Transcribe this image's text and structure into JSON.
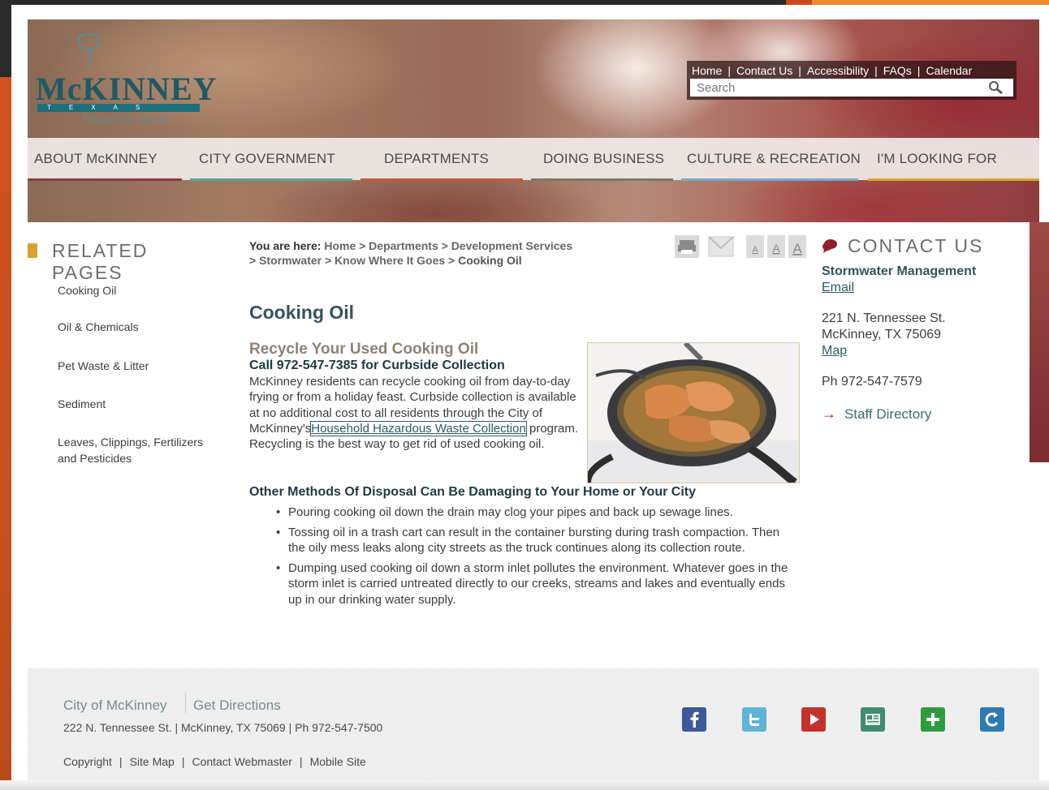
{
  "util": {
    "links": [
      "Home",
      "Contact Us",
      "Accessibility",
      "FAQs",
      "Calendar"
    ],
    "sep": "|",
    "search_placeholder": "Search"
  },
  "logo": {
    "word": "McKINNEY",
    "band": "TEXAS",
    "tagline": "Unique by nature."
  },
  "nav": {
    "items": [
      "ABOUT McKINNEY",
      "CITY GOVERNMENT",
      "DEPARTMENTS",
      "DOING BUSINESS",
      "CULTURE & RECREATION",
      "I'M LOOKING FOR"
    ],
    "bar_colors": [
      "#8e3a3a",
      "#5aa39a",
      "#c35a3a",
      "#7c7a5a",
      "#79a8c9",
      "#d7a72a"
    ]
  },
  "related": {
    "title": "RELATED PAGES",
    "items": [
      "Cooking Oil",
      "Oil & Chemicals",
      "Pet Waste & Litter",
      "Sediment",
      "Leaves, Clippings, Fertilizers and Pesticides"
    ]
  },
  "breadcrumb": {
    "prefix": "You are here:",
    "path": "Home > Departments > Development Services > Stormwater > Know Where It Goes >",
    "current": "Cooking Oil"
  },
  "content": {
    "title": "Cooking Oil",
    "subtitle": "Recycle Your Used Cooking Oil",
    "call": "Call 972-547-7385 for Curbside Collection",
    "para_before": "McKinney residents can recycle cooking oil from day-to-day frying or from a holiday feast. Curbside collection is available at no additional cost to all residents through the City of McKinney's",
    "para_link": "Household Hazardous Waste Collection",
    "para_after": " program. Recycling is the best way to get rid of used cooking oil.",
    "disposal_heading": "Other Methods Of Disposal Can Be Damaging to Your Home or Your City",
    "bullets": [
      "Pouring cooking oil down the drain may clog your pipes and back up sewage lines.",
      "Tossing oil in a trash cart can result in the container bursting during trash compaction. Then the oily mess leaks along city streets as the truck continues along its collection route.",
      "Dumping used cooking oil down a storm inlet pollutes the environment. Whatever goes in the storm inlet is carried untreated directly to our creeks, streams and lakes and eventually ends up in our drinking water supply."
    ]
  },
  "tools": {
    "icons": [
      "print-icon",
      "email-icon",
      "text-size-small-icon",
      "text-size-medium-icon",
      "text-size-large-icon"
    ],
    "size_label": "A"
  },
  "contact": {
    "title": "CONTACT US",
    "dept": "Stormwater Management",
    "email": "Email",
    "address1": "221 N. Tennessee St.",
    "address2": "McKinney, TX  75069",
    "map": "Map",
    "phone": "Ph 972-547-7579",
    "staff": "Staff Directory",
    "arrow": "→"
  },
  "footer": {
    "city": "City of McKinney",
    "directions": "Get Directions",
    "address": "222 N. Tennessee St. | McKinney, TX 75069 | Ph 972-547-7500",
    "links": [
      "Copyright",
      "Site Map",
      "Contact Webmaster",
      "Mobile Site"
    ],
    "sep": "|",
    "social": [
      "facebook-icon",
      "twitter-icon",
      "youtube-icon",
      "news-icon",
      "add-icon",
      "refresh-icon"
    ]
  }
}
